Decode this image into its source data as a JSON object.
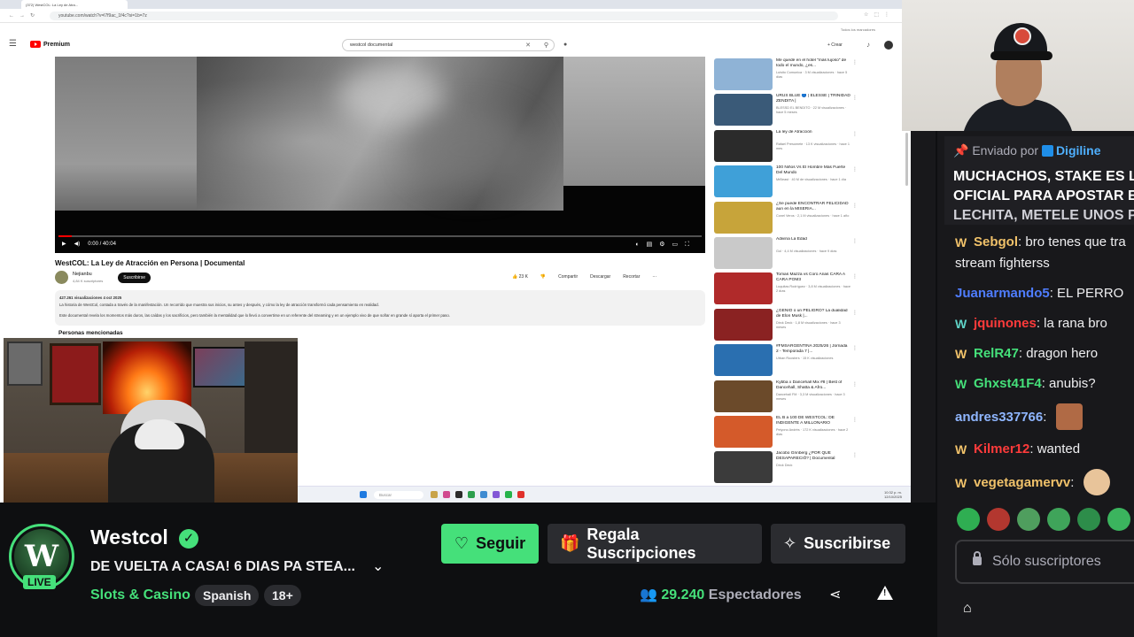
{
  "browser": {
    "tab_title": "(372) WestCOL: La Ley de Atra...",
    "url": "youtube.com/watch?v=l7f9ac_1f4c?si=1b=7z",
    "bookmarks": "Todos los marcadores"
  },
  "youtube": {
    "logo": "Premium",
    "search_value": "westcol documental",
    "create_label": "+ Crear",
    "player_time": "0:00 / 40:04",
    "video_title": "WestCOL: La Ley de Atracción en Persona | Documental",
    "channel_name": "Nejianbu",
    "channel_subs": "4,84 K suscriptores",
    "subscribe_label": "Suscribirse",
    "actions": [
      "23 K",
      "Compartir",
      "Descargar",
      "Recortar"
    ],
    "desc_meta": "427.261 visualizaciones  4 oct 2025",
    "desc_line1": "La historia de WestCol, contada a través de la manifestación. Un recorrido que muestra sus inicios, su antes y después, y cómo la ley de atracción transformó cada pensamiento en realidad.",
    "desc_line2": "Este documental revela los momentos más duros, las caídas y los sacrificios, pero también la mentalidad que lo llevó a convertirse en un referente del streaming y en un ejemplo vivo de que soñar en grande sí aporta el primer paso.",
    "people_heading": "Personas mencionadas",
    "taskbar_search": "Buscar",
    "taskbar_time": "10:32 p. m.",
    "taskbar_date": "12/10/2025",
    "related": [
      {
        "title": "Me quedé en el hotel \"más lujoso\" de todo el mundo, ¿es...",
        "meta": "Luisito Comunica · 3 M visualizaciones · hace 5 días",
        "color": "#8fb3d6"
      },
      {
        "title": "URUS BLUE 🔵 | ELESSE | TRINIDAD ZENDITA |",
        "meta": "BLESSD EL BENDITO · 22 M visualizaciones · hace 5 meses",
        "color": "#3a5a78"
      },
      {
        "title": "La ley de Atracción",
        "meta": "Rafael Presúmete · 13 K visualizaciones · hace 1 mes",
        "color": "#2b2b2b"
      },
      {
        "title": "100 Niños Vs El Hombre Más Fuerte Del Mundo",
        "meta": "MrBeast · 40 M de visualizaciones · hace 1 día",
        "color": "#3fa0d8"
      },
      {
        "title": "¿Se puede ENCONTRAR FELICIDAD aun en la MISERIA...",
        "meta": "Conel Veros · 2,1 M visualizaciones · hace 1 año",
        "color": "#c7a43a"
      },
      {
        "title": "Adivina La Edad",
        "meta": "Gol · 4,4 M visualizaciones · hace 9 días",
        "color": "#c9c9c9"
      },
      {
        "title": "Tomas Mazza vs Coro Arias CARA A CARA POM3",
        "meta": "Luquitas Rodríguez · 3,8 M visualizaciones · hace 2 días",
        "color": "#b02a2a"
      },
      {
        "title": "¿GENIO o un PELIGRO? La dualidad de Elon Musk |...",
        "meta": "Dirck Deck · 1,8 M visualizaciones · hace 3 meses",
        "color": "#8a2222"
      },
      {
        "title": "#FMSARGENTINA 2025/26 | Jornada 2 - Temporada 7 |...",
        "meta": "Urban Roosters · 15 K visualizaciones",
        "color": "#2a6fb0"
      },
      {
        "title": "Kybba x Dancehall Mix #8 | Best of Dancehall, Shatta & Afro...",
        "meta": "Dancehall FM · 3,3 M visualizaciones · hace 3 meses",
        "color": "#6b4a2a"
      },
      {
        "title": "EL B a 100 DE WESTCOL: DE INDIGENTE A MILLONARIO",
        "meta": "Peiyono Andrés · 172 K visualizaciones · hace 2 días",
        "color": "#d45a2a"
      },
      {
        "title": "Jacobo Grinberg ¿POR QUÉ DESAPARECIÓ? | Documental",
        "meta": "Dirck Deck",
        "color": "#3b3b3b"
      }
    ]
  },
  "chat": {
    "pinned_prefix": "Enviado por",
    "pinned_user": "Digiline",
    "pinned_lines": [
      "MUCHACHOS, STAKE ES LA",
      "OFICIAL PARA APOSTAR E",
      "LECHITA, METELE UNOS PA"
    ],
    "messages": [
      {
        "user": "Sebgol",
        "color": "#f1c26a",
        "text": " bro tenes que tra",
        "cont": "stream fighterss",
        "badge": "W",
        "badge_class": "b-w"
      },
      {
        "user": "Juanarmando5",
        "color": "#4f7dff",
        "text": " EL PERRO",
        "badge": "",
        "badge_class": ""
      },
      {
        "user": "jquinones",
        "color": "#ff3b3b",
        "text": " la rana bro",
        "badge": "W",
        "badge_class": "b-wt"
      },
      {
        "user": "RelR47",
        "color": "#45e07a",
        "text": " dragon hero",
        "badge": "W",
        "badge_class": "b-w"
      },
      {
        "user": "Ghxst41F4",
        "color": "#45e07a",
        "text": " anubis?",
        "badge": "W",
        "badge_class": "b-wg"
      },
      {
        "user": "andres337766",
        "color": "#8fb6ff",
        "text": " ",
        "badge": "",
        "badge_class": ""
      },
      {
        "user": "Kilmer12",
        "color": "#ff3b3b",
        "text": " wanted",
        "badge": "W",
        "badge_class": "b-w"
      },
      {
        "user": "vegetagamervv",
        "color": "#f1c26a",
        "text": " ",
        "badge": "W",
        "badge_class": "b-w"
      }
    ],
    "input_placeholder": "Sólo suscriptores"
  },
  "stream": {
    "streamer": "Westcol",
    "avatar_letters": "W",
    "live_label": "LIVE",
    "title": "DE VUELTA A CASA! 6 DIAS PA STEA...",
    "category": "Slots & Casino",
    "tags": [
      "Spanish",
      "18+"
    ],
    "follow_label": "Seguir",
    "gift_label": "Regala Suscripciones",
    "subscribe_label": "Suscribirse",
    "viewer_count": "29.240",
    "viewer_label": "Espectadores",
    "accent": "#45e07a"
  }
}
